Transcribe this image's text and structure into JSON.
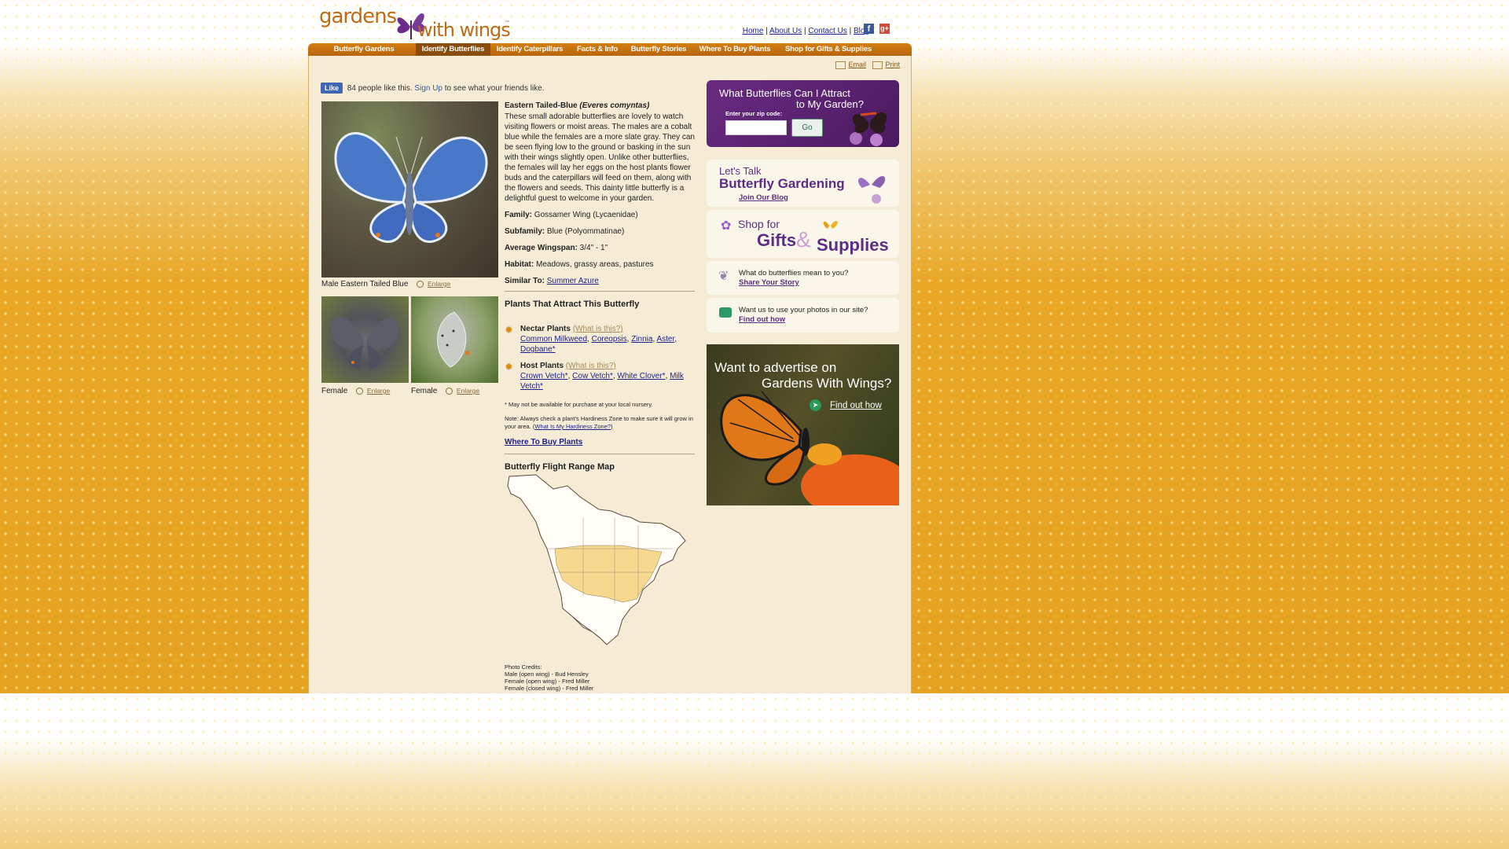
{
  "header": {
    "logo_word1": "gardens",
    "logo_word2": "with wings",
    "logo_tm": "™",
    "links": [
      "Home",
      "About Us",
      "Contact Us",
      "Blog"
    ],
    "separators": "|"
  },
  "nav": {
    "items": [
      "Butterfly Gardens",
      "Identify Butterflies",
      "Identify Caterpillars",
      "Facts & Info",
      "Butterfly Stories",
      "Where To Buy Plants",
      "Shop for Gifts & Supplies"
    ],
    "active_index": 1
  },
  "share": {
    "email": "Email",
    "print": "Print"
  },
  "like": {
    "button": "Like",
    "text": "84 people like this.",
    "signup": "Sign Up",
    "after": "to see what your friends like."
  },
  "photos": {
    "main_caption": "Male Eastern Tailed Blue",
    "enlarge": "Enlarge",
    "female1": "Female",
    "female2": "Female"
  },
  "butterfly": {
    "name": "Eastern Tailed-Blue",
    "latin": "(Everes comyntas)",
    "description": "These small adorable butterflies are lovely to watch visiting flowers or moist areas. The males are a cobalt blue while the females are a more slate gray. They can be seen flying low to the ground or basking in the sun with their wings slightly open. Unlike other butterflies, the females will lay her eggs on the host plants flower buds and the caterpillars will feed on them, along with the flowers and seeds. This dainty little butterfly is a delightful guest to welcome in your garden.",
    "family_label": "Family:",
    "family": "Gossamer Wing (Lycaenidae)",
    "subfamily_label": "Subfamily:",
    "subfamily": "Blue (Polyommatinae)",
    "wingspan_label": "Average Wingspan:",
    "wingspan": "3/4\" - 1\"",
    "habitat_label": "Habitat:",
    "habitat": "Meadows, grassy areas, pastures",
    "similar_label": "Similar To:",
    "similar": "Summer Azure"
  },
  "plants": {
    "title": "Plants That Attract This Butterfly",
    "nectar_label": "Nectar Plants",
    "what": "(What is this?)",
    "nectar": [
      "Common Milkweed",
      "Coreopsis",
      "Zinnia",
      "Aster",
      "Dogbane*"
    ],
    "host_label": "Host Plants",
    "host": [
      "Crown Vetch*",
      "Cow Vetch*",
      "White Clover*",
      "Milk Vetch*"
    ],
    "note1": "* May not be available for purchase at your local nursery.",
    "note2_pre": "Note: Always check a plant's Hardiness Zone to make sure it will grow in your area. (",
    "note2_link": "What Is My Hardiness Zone?",
    "note2_post": ")",
    "where_buy": "Where To Buy Plants"
  },
  "map": {
    "title": "Butterfly Flight Range Map"
  },
  "credits": {
    "title": "Photo Credits:",
    "lines": [
      "Male (open wing) - Bud Hensley",
      "Female (open wing) - Fred Miller",
      "Female (closed wing) - Fred Miller"
    ]
  },
  "sidebar": {
    "zip_title1": "What Butterflies Can I Attract",
    "zip_title2": "to My Garden?",
    "zip_label": "Enter your zip code:",
    "zip_value": "",
    "go": "Go",
    "blog_lets": "Let's Talk",
    "blog_title": "Butterfly Gardening",
    "blog_join": "Join Our Blog",
    "shop1": "Shop for",
    "shop2": "Gifts",
    "shop_amp": "&",
    "shop3": "Supplies",
    "story_q": "What do butterflies mean to you?",
    "story_l": "Share Your Story",
    "photos_q": "Want us to use your photos in our site?",
    "photos_l": "Find out how",
    "ad1": "Want to advertise on",
    "ad2": "Gardens With Wings?",
    "ad_link": "Find out how"
  }
}
